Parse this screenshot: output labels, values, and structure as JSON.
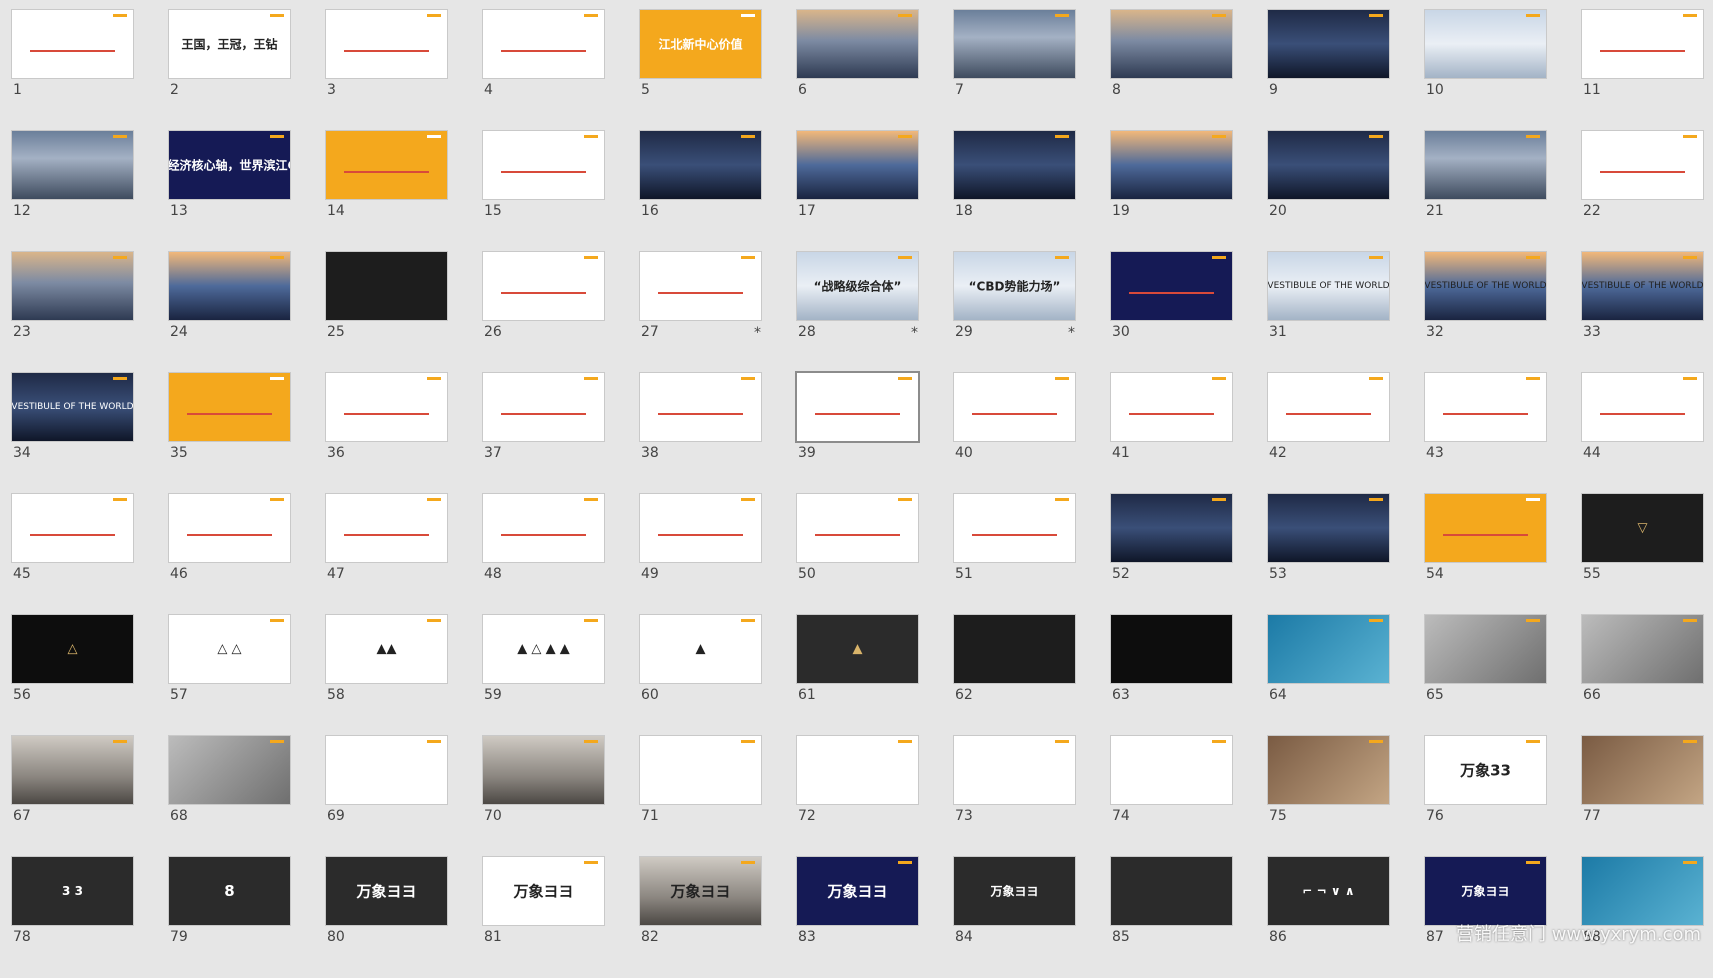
{
  "slides": [
    {
      "num": "1",
      "theme": "t-white",
      "text": "",
      "kind": "doc"
    },
    {
      "num": "2",
      "theme": "t-white",
      "text": "王国，王冠，王钻",
      "kind": "big"
    },
    {
      "num": "3",
      "theme": "t-white",
      "text": "",
      "kind": "doc"
    },
    {
      "num": "4",
      "theme": "t-white",
      "text": "",
      "kind": "doc"
    },
    {
      "num": "5",
      "theme": "t-orange",
      "text": "江北新中心价值",
      "kind": "big"
    },
    {
      "num": "6",
      "theme": "t-city",
      "text": "",
      "kind": "photo"
    },
    {
      "num": "7",
      "theme": "t-photo",
      "text": "",
      "kind": "photo"
    },
    {
      "num": "8",
      "theme": "t-city",
      "text": "",
      "kind": "photo"
    },
    {
      "num": "9",
      "theme": "t-night",
      "text": "",
      "kind": "photo"
    },
    {
      "num": "10",
      "theme": "t-sky",
      "text": "",
      "kind": "photo"
    },
    {
      "num": "11",
      "theme": "t-white",
      "text": "",
      "kind": "doc"
    },
    {
      "num": "12",
      "theme": "t-photo",
      "text": "",
      "kind": "photo"
    },
    {
      "num": "13",
      "theme": "t-navy",
      "text": "中国经济核心轴，世界滨江CBD",
      "kind": "big"
    },
    {
      "num": "14",
      "theme": "t-orange",
      "text": "",
      "kind": "doc"
    },
    {
      "num": "15",
      "theme": "t-white",
      "text": "",
      "kind": "doc"
    },
    {
      "num": "16",
      "theme": "t-night",
      "text": "",
      "kind": "photo"
    },
    {
      "num": "17",
      "theme": "t-dusk",
      "text": "",
      "kind": "photo"
    },
    {
      "num": "18",
      "theme": "t-night",
      "text": "",
      "kind": "photo"
    },
    {
      "num": "19",
      "theme": "t-dusk",
      "text": "",
      "kind": "photo"
    },
    {
      "num": "20",
      "theme": "t-night",
      "text": "",
      "kind": "photo"
    },
    {
      "num": "21",
      "theme": "t-photo",
      "text": "",
      "kind": "photo"
    },
    {
      "num": "22",
      "theme": "t-white",
      "text": "",
      "kind": "doc"
    },
    {
      "num": "23",
      "theme": "t-city",
      "text": "",
      "kind": "photo"
    },
    {
      "num": "24",
      "theme": "t-dusk",
      "text": "",
      "kind": "photo"
    },
    {
      "num": "25",
      "theme": "t-dark",
      "text": "",
      "kind": "photo"
    },
    {
      "num": "26",
      "theme": "t-white",
      "text": "",
      "kind": "doc"
    },
    {
      "num": "27",
      "theme": "t-white",
      "text": "",
      "kind": "doc",
      "star": "*"
    },
    {
      "num": "28",
      "theme": "t-sky",
      "text": "“战略级综合体”",
      "kind": "big",
      "star": "*"
    },
    {
      "num": "29",
      "theme": "t-sky",
      "text": "“CBD势能力场”",
      "kind": "big",
      "star": "*"
    },
    {
      "num": "30",
      "theme": "t-navy",
      "text": "",
      "kind": "doc"
    },
    {
      "num": "31",
      "theme": "t-sky",
      "text": "VESTIBULE OF THE WORLD",
      "kind": "small"
    },
    {
      "num": "32",
      "theme": "t-dusk",
      "text": "VESTIBULE OF THE WORLD",
      "kind": "small"
    },
    {
      "num": "33",
      "theme": "t-dusk",
      "text": "VESTIBULE OF THE WORLD",
      "kind": "small"
    },
    {
      "num": "34",
      "theme": "t-night",
      "text": "VESTIBULE OF THE WORLD",
      "kind": "small"
    },
    {
      "num": "35",
      "theme": "t-orange",
      "text": "",
      "kind": "doc"
    },
    {
      "num": "36",
      "theme": "t-white",
      "text": "",
      "kind": "doc"
    },
    {
      "num": "37",
      "theme": "t-white",
      "text": "",
      "kind": "doc"
    },
    {
      "num": "38",
      "theme": "t-white",
      "text": "",
      "kind": "doc"
    },
    {
      "num": "39",
      "theme": "t-white",
      "text": "",
      "kind": "doc",
      "selected": true
    },
    {
      "num": "40",
      "theme": "t-white",
      "text": "",
      "kind": "doc"
    },
    {
      "num": "41",
      "theme": "t-white",
      "text": "",
      "kind": "doc"
    },
    {
      "num": "42",
      "theme": "t-white",
      "text": "",
      "kind": "doc"
    },
    {
      "num": "43",
      "theme": "t-white",
      "text": "",
      "kind": "doc"
    },
    {
      "num": "44",
      "theme": "t-white",
      "text": "",
      "kind": "doc"
    },
    {
      "num": "45",
      "theme": "t-white",
      "text": "",
      "kind": "doc"
    },
    {
      "num": "46",
      "theme": "t-white",
      "text": "",
      "kind": "doc"
    },
    {
      "num": "47",
      "theme": "t-white",
      "text": "",
      "kind": "doc"
    },
    {
      "num": "48",
      "theme": "t-white",
      "text": "",
      "kind": "doc"
    },
    {
      "num": "49",
      "theme": "t-white",
      "text": "",
      "kind": "doc"
    },
    {
      "num": "50",
      "theme": "t-white",
      "text": "",
      "kind": "doc"
    },
    {
      "num": "51",
      "theme": "t-white",
      "text": "",
      "kind": "doc"
    },
    {
      "num": "52",
      "theme": "t-night",
      "text": "",
      "kind": "photo"
    },
    {
      "num": "53",
      "theme": "t-night",
      "text": "",
      "kind": "photo"
    },
    {
      "num": "54",
      "theme": "t-orange",
      "text": "",
      "kind": "doc"
    },
    {
      "num": "55",
      "theme": "t-dark",
      "text": "▽",
      "kind": "emblem"
    },
    {
      "num": "56",
      "theme": "t-black",
      "text": "△",
      "kind": "emblem"
    },
    {
      "num": "57",
      "theme": "t-white",
      "text": "△ △",
      "kind": "emblem"
    },
    {
      "num": "58",
      "theme": "t-white",
      "text": "▲▲",
      "kind": "emblem"
    },
    {
      "num": "59",
      "theme": "t-white",
      "text": "▲ △ ▲ ▲",
      "kind": "emblem"
    },
    {
      "num": "60",
      "theme": "t-white",
      "text": "▲",
      "kind": "emblem"
    },
    {
      "num": "61",
      "theme": "t-gray",
      "text": "▲",
      "kind": "emblem"
    },
    {
      "num": "62",
      "theme": "t-dark",
      "text": "",
      "kind": "photo"
    },
    {
      "num": "63",
      "theme": "t-black",
      "text": "",
      "kind": "photo"
    },
    {
      "num": "64",
      "theme": "t-teal",
      "text": "",
      "kind": "photo"
    },
    {
      "num": "65",
      "theme": "t-silver",
      "text": "",
      "kind": "photo"
    },
    {
      "num": "66",
      "theme": "t-silver",
      "text": "",
      "kind": "photo"
    },
    {
      "num": "67",
      "theme": "t-room",
      "text": "",
      "kind": "photo"
    },
    {
      "num": "68",
      "theme": "t-silver",
      "text": "",
      "kind": "photo"
    },
    {
      "num": "69",
      "theme": "t-white",
      "text": "",
      "kind": "photo"
    },
    {
      "num": "70",
      "theme": "t-room",
      "text": "",
      "kind": "photo"
    },
    {
      "num": "71",
      "theme": "t-white",
      "text": "",
      "kind": "photo"
    },
    {
      "num": "72",
      "theme": "t-white",
      "text": "",
      "kind": "photo"
    },
    {
      "num": "73",
      "theme": "t-white",
      "text": "",
      "kind": "photo"
    },
    {
      "num": "74",
      "theme": "t-white",
      "text": "",
      "kind": "photo"
    },
    {
      "num": "75",
      "theme": "t-brown",
      "text": "",
      "kind": "photo"
    },
    {
      "num": "76",
      "theme": "t-white",
      "text": "万象33",
      "kind": "xl"
    },
    {
      "num": "77",
      "theme": "t-brown",
      "text": "",
      "kind": "photo"
    },
    {
      "num": "78",
      "theme": "t-gray",
      "text": "3  3",
      "kind": "big"
    },
    {
      "num": "79",
      "theme": "t-gray",
      "text": "8",
      "kind": "xl"
    },
    {
      "num": "80",
      "theme": "t-gray",
      "text": "万象ヨヨ",
      "kind": "xl"
    },
    {
      "num": "81",
      "theme": "t-white",
      "text": "万象ヨヨ",
      "kind": "xl"
    },
    {
      "num": "82",
      "theme": "t-room",
      "text": "万象ヨヨ",
      "kind": "xl"
    },
    {
      "num": "83",
      "theme": "t-navy",
      "text": "万象ヨヨ",
      "kind": "xl"
    },
    {
      "num": "84",
      "theme": "t-gray",
      "text": "万象ヨヨ",
      "kind": "big"
    },
    {
      "num": "85",
      "theme": "t-gray",
      "text": "",
      "kind": "photo"
    },
    {
      "num": "86",
      "theme": "t-gray",
      "text": "⌐ ¬ ∨ ∧",
      "kind": "big"
    },
    {
      "num": "87",
      "theme": "t-navy",
      "text": "万象ヨヨ",
      "kind": "big"
    },
    {
      "num": "88",
      "theme": "t-teal",
      "text": "",
      "kind": "photo"
    }
  ],
  "watermark": "营销任意门 www.yxrym.com"
}
